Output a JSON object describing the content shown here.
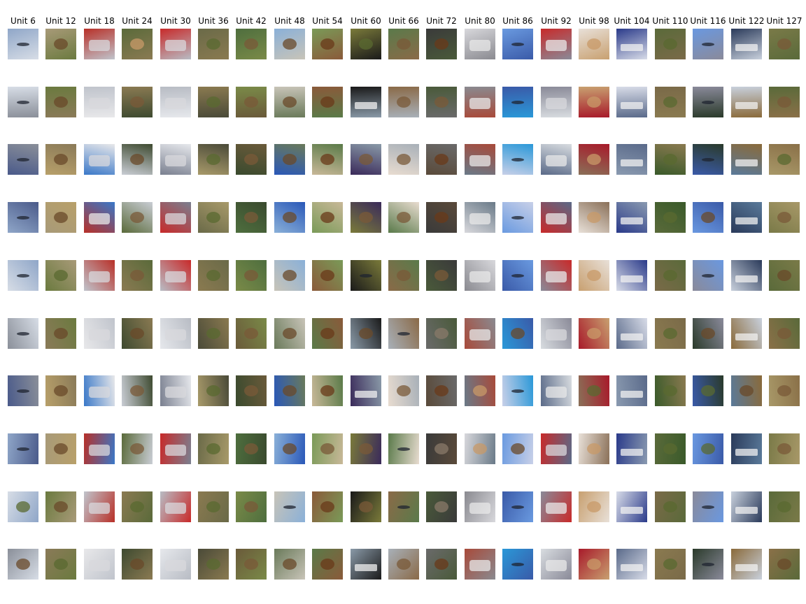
{
  "figure": {
    "columns": [
      {
        "title": "Unit 6",
        "palette": [
          "#8fa6c8",
          "#d7dde6",
          "#8a8f99",
          "#4a5a8a"
        ],
        "subjects": [
          "airplane",
          "airplane",
          "airplane",
          "airplane",
          "airplane",
          "airplane",
          "airplane",
          "airplane",
          "frog",
          "bird"
        ]
      },
      {
        "title": "Unit 12",
        "palette": [
          "#a89a78",
          "#6b7a3f",
          "#8a7a58",
          "#b8a06a"
        ],
        "subjects": [
          "bird",
          "bird",
          "bird",
          "bird",
          "frog",
          "bird",
          "bird",
          "bird",
          "bird",
          "frog"
        ]
      },
      {
        "title": "Unit 18",
        "palette": [
          "#b83028",
          "#c0c4cc",
          "#e8e8ea",
          "#3a78c8"
        ],
        "subjects": [
          "automobile",
          "automobile",
          "automobile",
          "truck",
          "automobile",
          "automobile",
          "automobile",
          "automobile",
          "automobile",
          "automobile"
        ]
      },
      {
        "title": "Unit 24",
        "palette": [
          "#5a6a3a",
          "#8a7a52",
          "#3e4a30",
          "#c9cdd4"
        ],
        "subjects": [
          "dog",
          "deer",
          "bird",
          "deer",
          "deer",
          "bird",
          "deer",
          "deer",
          "frog",
          "bird"
        ]
      },
      {
        "title": "Unit 30",
        "palette": [
          "#c82a2a",
          "#b8bcc4",
          "#e6e8ec",
          "#7a8090"
        ],
        "subjects": [
          "automobile",
          "automobile",
          "automobile",
          "automobile",
          "automobile",
          "automobile",
          "automobile",
          "automobile",
          "automobile",
          "automobile"
        ]
      },
      {
        "title": "Unit 36",
        "palette": [
          "#6a6a48",
          "#8a7a50",
          "#4a4a38",
          "#a89a6a"
        ],
        "subjects": [
          "frog",
          "frog",
          "frog",
          "frog",
          "frog",
          "frog",
          "frog",
          "frog",
          "frog",
          "frog"
        ]
      },
      {
        "title": "Unit 42",
        "palette": [
          "#4e6e3e",
          "#7a8a48",
          "#6a5a3a",
          "#3a4a2e"
        ],
        "subjects": [
          "deer",
          "deer",
          "deer",
          "deer",
          "deer",
          "deer",
          "deer",
          "deer",
          "deer",
          "deer"
        ]
      },
      {
        "title": "Unit 48",
        "palette": [
          "#8ab0d8",
          "#c8c4b8",
          "#6a7a5a",
          "#2a58b8"
        ],
        "subjects": [
          "bird",
          "bird",
          "bird",
          "bird",
          "bird",
          "bird",
          "bird",
          "bird",
          "airplane",
          "bird"
        ]
      },
      {
        "title": "Unit 54",
        "palette": [
          "#7a9a58",
          "#8a5a3a",
          "#5a7a48",
          "#c8b898"
        ],
        "subjects": [
          "horse",
          "horse",
          "horse",
          "horse",
          "horse",
          "horse",
          "horse",
          "deer",
          "horse",
          "horse"
        ]
      },
      {
        "title": "Unit 60",
        "palette": [
          "#7a7a3a",
          "#1a1a1a",
          "#8a9aa8",
          "#3a2a5a"
        ],
        "subjects": [
          "frog",
          "ship",
          "deer",
          "deer",
          "airplane",
          "bird",
          "ship",
          "deer",
          "deer",
          "ship"
        ]
      },
      {
        "title": "Unit 66",
        "palette": [
          "#5a7a4a",
          "#8a6a48",
          "#a8b0b8",
          "#e8dcd0"
        ],
        "subjects": [
          "deer",
          "deer",
          "deer",
          "deer",
          "deer",
          "airplane",
          "deer",
          "airplane",
          "airplane",
          "deer"
        ]
      },
      {
        "title": "Unit 72",
        "palette": [
          "#3a3a3a",
          "#4a5a3a",
          "#6a6a6a",
          "#5a4a3a"
        ],
        "subjects": [
          "horse",
          "deer",
          "horse",
          "horse",
          "deer",
          "cat",
          "horse",
          "cat",
          "cat",
          "horse"
        ]
      },
      {
        "title": "Unit 80",
        "palette": [
          "#d8d8dc",
          "#8a8a90",
          "#a84a3a",
          "#6a7a88"
        ],
        "subjects": [
          "truck",
          "truck",
          "truck",
          "truck",
          "truck",
          "truck",
          "dog",
          "dog",
          "truck",
          "truck"
        ]
      },
      {
        "title": "Unit 86",
        "palette": [
          "#6a9ae0",
          "#3a5aa8",
          "#2a98d8",
          "#c8d0e8"
        ],
        "subjects": [
          "airplane",
          "airplane",
          "airplane",
          "airplane",
          "airplane",
          "bird",
          "airplane",
          "bird",
          "airplane",
          "airplane"
        ]
      },
      {
        "title": "Unit 92",
        "palette": [
          "#c82a2a",
          "#8a8a98",
          "#d8dce0",
          "#5a6a88"
        ],
        "subjects": [
          "truck",
          "automobile",
          "truck",
          "truck",
          "truck",
          "automobile",
          "truck",
          "automobile",
          "truck",
          "truck"
        ]
      },
      {
        "title": "Unit 98",
        "palette": [
          "#e8e0d8",
          "#c8a070",
          "#a81a2a",
          "#8a7058"
        ],
        "subjects": [
          "dog",
          "dog",
          "dog",
          "dog",
          "dog",
          "dog",
          "frog",
          "dog",
          "dog",
          "dog"
        ]
      },
      {
        "title": "Unit 104",
        "palette": [
          "#2a3a8a",
          "#d8dce8",
          "#5a6a8a",
          "#8a9ab0"
        ],
        "subjects": [
          "ship",
          "ship",
          "ship",
          "ship",
          "ship",
          "ship",
          "ship",
          "ship",
          "ship",
          "ship"
        ]
      },
      {
        "title": "Unit 110",
        "palette": [
          "#5a6a3a",
          "#7a6a48",
          "#8a7a50",
          "#3a5a2a"
        ],
        "subjects": [
          "frog",
          "frog",
          "frog",
          "frog",
          "frog",
          "frog",
          "frog",
          "frog",
          "frog",
          "frog"
        ]
      },
      {
        "title": "Unit 116",
        "palette": [
          "#6a98e0",
          "#8a8a9a",
          "#2a3a2a",
          "#3a5aa8"
        ],
        "subjects": [
          "airplane",
          "airplane",
          "airplane",
          "bird",
          "airplane",
          "bird",
          "frog",
          "frog",
          "airplane",
          "airplane"
        ]
      },
      {
        "title": "Unit 122",
        "palette": [
          "#2a3a5a",
          "#c8d0dc",
          "#8a6a3a",
          "#5a7a9a"
        ],
        "subjects": [
          "ship",
          "ship",
          "ship",
          "ship",
          "ship",
          "ship",
          "bird",
          "ship",
          "ship",
          "ship"
        ]
      },
      {
        "title": "Unit 127",
        "palette": [
          "#7a7a48",
          "#5a6a3a",
          "#8a7048",
          "#a89868"
        ],
        "subjects": [
          "deer",
          "deer",
          "frog",
          "deer",
          "bird",
          "deer",
          "deer",
          "deer",
          "frog",
          "bird"
        ]
      }
    ],
    "rows": 10,
    "subject_colors": {
      "airplane": "#1f2430",
      "bird": "#6a4a2a",
      "automobile": "#d8d8dc",
      "truck": "#e8e8e8",
      "dog": "#c89a68",
      "deer": "#7a5a38",
      "frog": "#5a6a30",
      "horse": "#6a3a1a",
      "ship": "#f0f0f0",
      "cat": "#8a7a6a"
    }
  }
}
